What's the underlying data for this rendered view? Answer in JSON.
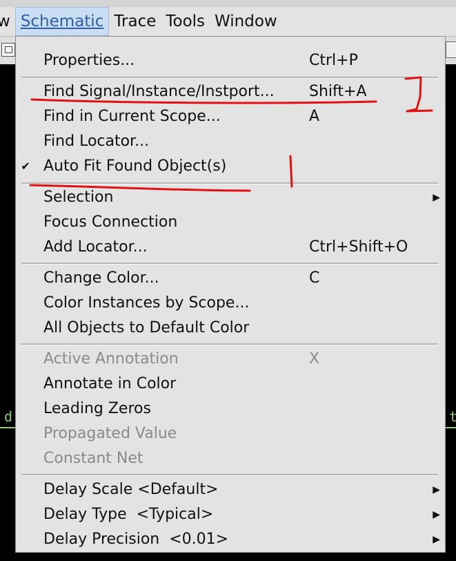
{
  "menubar": {
    "items": [
      {
        "label": "w"
      },
      {
        "label": "Schematic"
      },
      {
        "label": "Trace"
      },
      {
        "label": "Tools"
      },
      {
        "label": "Window"
      }
    ]
  },
  "canvas": {
    "left_text": "d",
    "right_text": "t"
  },
  "menu": {
    "items": [
      {
        "label": "Properties...",
        "shortcut": "Ctrl+P",
        "enabled": true
      },
      {
        "label": "Find Signal/Instance/Instport...",
        "shortcut": "Shift+A",
        "enabled": true
      },
      {
        "label": "Find in Current Scope...",
        "shortcut": "A",
        "enabled": true
      },
      {
        "label": "Find Locator...",
        "shortcut": "",
        "enabled": true
      },
      {
        "label": "Auto Fit Found Object(s)",
        "shortcut": "",
        "checked": true,
        "enabled": true
      },
      {
        "label": "Selection",
        "shortcut": "",
        "submenu": true,
        "enabled": true
      },
      {
        "label": "Focus Connection",
        "shortcut": "",
        "enabled": true
      },
      {
        "label": "Add Locator...",
        "shortcut": "Ctrl+Shift+O",
        "enabled": true
      },
      {
        "label": "Change Color...",
        "shortcut": "C",
        "enabled": true
      },
      {
        "label": "Color Instances by Scope...",
        "shortcut": "",
        "enabled": true
      },
      {
        "label": "All Objects to Default Color",
        "shortcut": "",
        "enabled": true
      },
      {
        "label": "Active Annotation",
        "shortcut": "X",
        "enabled": false
      },
      {
        "label": "Annotate in Color",
        "shortcut": "",
        "enabled": true
      },
      {
        "label": "Leading Zeros",
        "shortcut": "",
        "enabled": true
      },
      {
        "label": "Propagated Value",
        "shortcut": "",
        "enabled": false
      },
      {
        "label": "Constant Net",
        "shortcut": "",
        "enabled": false
      },
      {
        "label": "Delay Scale <Default>",
        "shortcut": "",
        "submenu": true,
        "enabled": true
      },
      {
        "label": "Delay Type  <Typical>",
        "shortcut": "",
        "submenu": true,
        "enabled": true
      },
      {
        "label": "Delay Precision  <0.01>",
        "shortcut": "",
        "submenu": true,
        "enabled": true
      }
    ]
  },
  "icons": {
    "check": "✔",
    "submenu_arrow": "▶"
  },
  "colors": {
    "annotation": "#e01010",
    "active_menu_bg": "#c9ddf3",
    "active_menu_text": "#2f5fa5",
    "disabled_text": "#8a8a8a"
  }
}
